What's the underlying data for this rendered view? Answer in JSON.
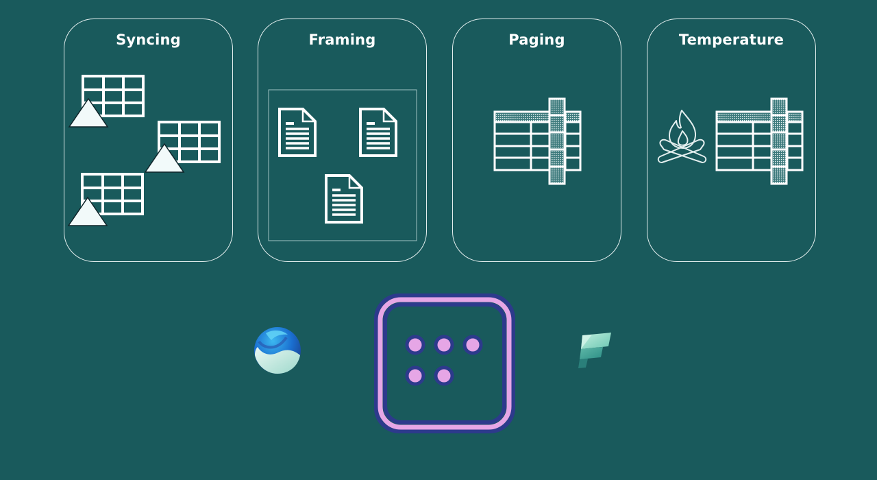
{
  "cards": [
    {
      "title": "Syncing",
      "icon": "table-warning-icon"
    },
    {
      "title": "Framing",
      "icon": "document-icon"
    },
    {
      "title": "Paging",
      "icon": "table-columns-icon"
    },
    {
      "title": "Temperature",
      "icon": "campfire-icon"
    }
  ],
  "logos": [
    {
      "icon": "sphere-logo-icon"
    },
    {
      "icon": "dots-tile-logo-icon"
    },
    {
      "icon": "fabric-logo-icon"
    }
  ],
  "colors": {
    "background": "#195a5c",
    "line": "#ffffff",
    "accent_pink": "#e6a6e6",
    "accent_navy": "#2d3a8c"
  }
}
